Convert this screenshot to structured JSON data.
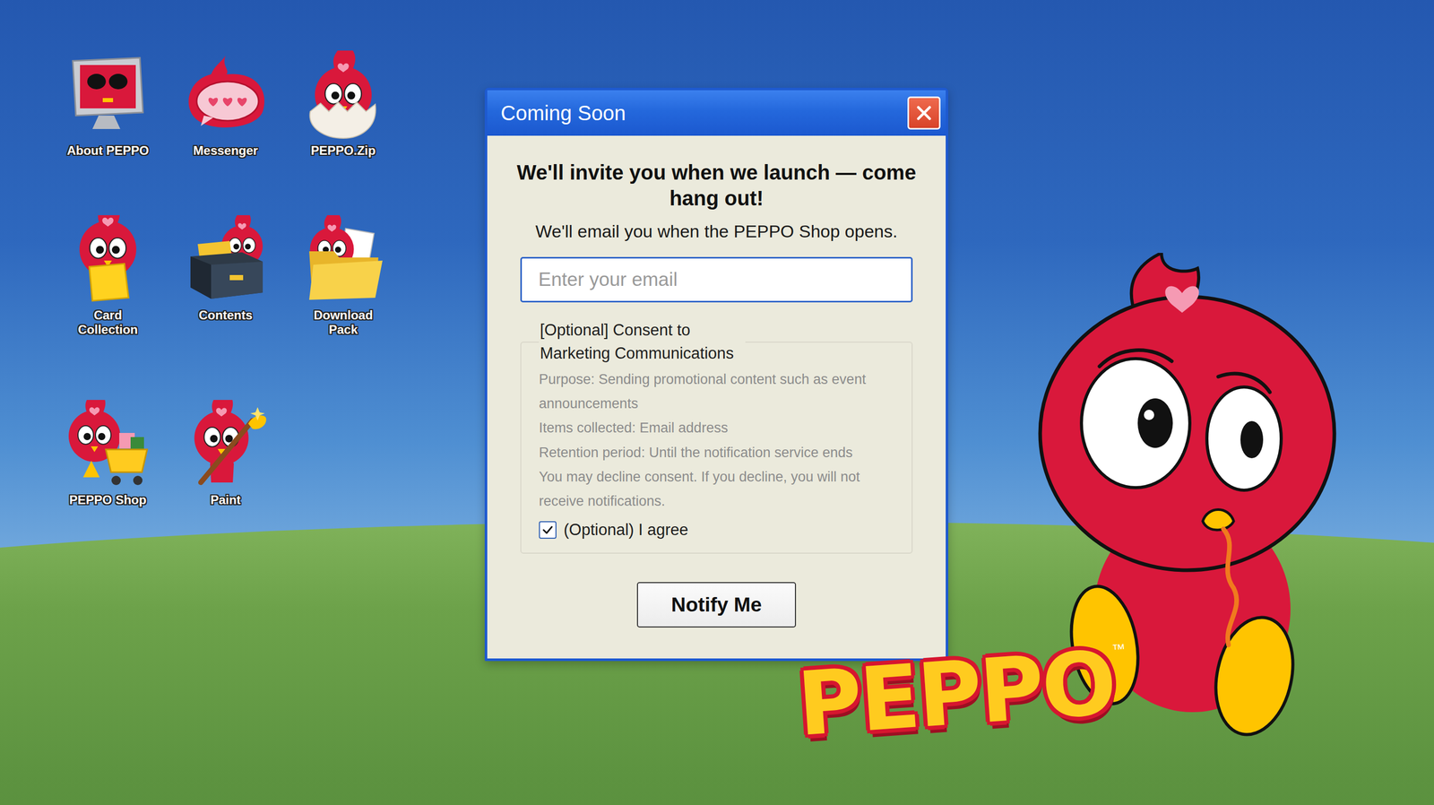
{
  "desktop_icons": [
    {
      "label": "About PEPPO"
    },
    {
      "label": "Messenger"
    },
    {
      "label": "PEPPO.Zip"
    },
    {
      "label": "Card Collection"
    },
    {
      "label": "Contents"
    },
    {
      "label": "Download Pack"
    },
    {
      "label": "PEPPO Shop"
    },
    {
      "label": "Paint"
    }
  ],
  "window": {
    "title": "Coming Soon"
  },
  "heading": "We'll invite you when we launch — come hang out!",
  "subtext": "We'll email you when the PEPPO Shop opens.",
  "email_field": {
    "placeholder": "Enter your email",
    "value": ""
  },
  "consent": {
    "title": "[Optional] Consent to Marketing Communications",
    "lines": [
      "Purpose: Sending promotional content such as event announcements",
      "Items collected: Email address",
      "Retention period: Until the notification service ends",
      "You may decline consent. If you decline, you will not receive notifications."
    ],
    "checkbox": {
      "label": "(Optional) I agree",
      "checked": true
    }
  },
  "button": "Notify Me",
  "logo": {
    "text": "PEPPO",
    "mark": "™"
  }
}
